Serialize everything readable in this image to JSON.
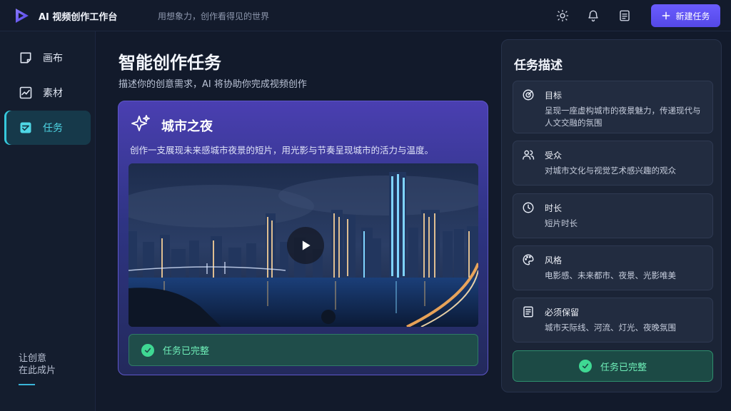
{
  "header": {
    "app_title": "AI 视频创作工作台",
    "slogan": "用想象力，创作看得见的世界",
    "new_task_label": "新建任务",
    "icons": [
      "sun-icon",
      "bell-icon",
      "document-icon",
      "plus-icon"
    ]
  },
  "sidebar": {
    "items": [
      {
        "label": "画布",
        "icon": "canvas-icon",
        "active": false
      },
      {
        "label": "素材",
        "icon": "chart-icon",
        "active": false
      },
      {
        "label": "任务",
        "icon": "task-check-icon",
        "active": true
      }
    ],
    "footer_line1": "让创意",
    "footer_line2": "在此成片"
  },
  "main": {
    "title": "智能创作任务",
    "subtitle": "描述你的创意需求，AI 将协助你完成视频创作",
    "card": {
      "title": "城市之夜",
      "description": "创作一支展现未来感城市夜景的短片，用光影与节奏呈现城市的活力与温度。",
      "status": "任务已完整"
    }
  },
  "panel": {
    "title": "任务描述",
    "fields": [
      {
        "label": "目标",
        "value": "呈现一座虚构城市的夜景魅力，传递现代与人文交融的氛围",
        "icon": "target-icon"
      },
      {
        "label": "受众",
        "value": "对城市文化与视觉艺术感兴趣的观众",
        "icon": "users-icon"
      },
      {
        "label": "时长",
        "value": "短片时长",
        "icon": "clock-icon"
      },
      {
        "label": "风格",
        "value": "电影感、未来都市、夜景、光影唯美",
        "icon": "palette-icon"
      },
      {
        "label": "必须保留",
        "value": "城市天际线、河流、灯光、夜晚氛围",
        "icon": "list-doc-icon"
      }
    ],
    "complete_label": "任务已完整"
  },
  "colors": {
    "accent": "#5a4cf0",
    "active_nav": "#36c8dc",
    "success": "#3fd893"
  }
}
